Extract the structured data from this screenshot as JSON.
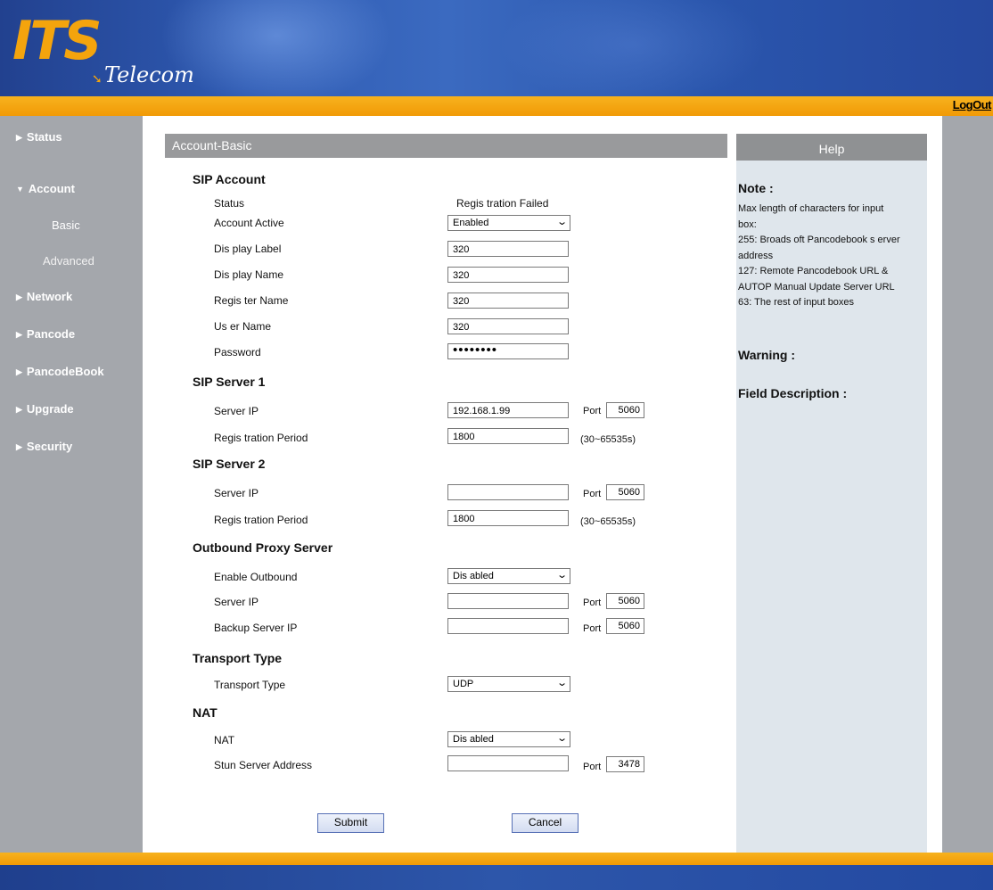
{
  "brand": {
    "its": "ITS",
    "telecom": "Telecom"
  },
  "topbar": {
    "logout": "LogOut"
  },
  "sidebar": {
    "items": [
      {
        "label": "Status"
      },
      {
        "label": "Account"
      },
      {
        "label": "Network"
      },
      {
        "label": "Pancode"
      },
      {
        "label": "PancodeBook"
      },
      {
        "label": "Upgrade"
      },
      {
        "label": "Security"
      }
    ],
    "account_sub": [
      "Basic",
      "Advanced"
    ]
  },
  "page": {
    "title": "Account-Basic"
  },
  "sip_account": {
    "heading": "SIP Account",
    "status_label": "Status",
    "status_value": "Regis tration Failed",
    "account_active_label": "Account Active",
    "account_active_value": "Enabled",
    "display_label_label": "Dis play Label",
    "display_label_value": "320",
    "display_name_label": "Dis play Name",
    "display_name_value": "320",
    "register_name_label": "Regis ter Name",
    "register_name_value": "320",
    "user_name_label": "Us er Name",
    "user_name_value": "320",
    "password_label": "Password",
    "password_value": "••••••••"
  },
  "sip_server1": {
    "heading": "SIP Server 1",
    "server_ip_label": "Server IP",
    "server_ip_value": "192.168.1.99",
    "port_label": "Port",
    "port_value": "5060",
    "reg_period_label": "Regis tration Period",
    "reg_period_value": "1800",
    "range": "(30~65535s)"
  },
  "sip_server2": {
    "heading": "SIP Server 2",
    "server_ip_label": "Server IP",
    "server_ip_value": "",
    "port_label": "Port",
    "port_value": "5060",
    "reg_period_label": "Regis tration Period",
    "reg_period_value": "1800",
    "range": "(30~65535s)"
  },
  "outbound": {
    "heading": "Outbound Proxy Server",
    "enable_label": "Enable Outbound",
    "enable_value": "Dis abled",
    "server_ip_label": "Server IP",
    "server_ip_value": "",
    "port_label": "Port",
    "port_value": "5060",
    "backup_label": "Backup Server IP",
    "backup_value": "",
    "backup_port_label": "Port",
    "backup_port_value": "5060"
  },
  "transport": {
    "heading": "Transport Type",
    "label": "Transport Type",
    "value": "UDP"
  },
  "nat": {
    "heading": "NAT",
    "label": "NAT",
    "value": "Dis abled",
    "stun_label": "Stun Server Address",
    "stun_value": "",
    "port_label": "Port",
    "port_value": "3478"
  },
  "buttons": {
    "submit": "Submit",
    "cancel": "Cancel"
  },
  "help": {
    "title": "Help",
    "note_heading": "Note :",
    "note_lines": [
      "Max length of characters for input",
      "box:",
      "255: Broads oft Pancodebook s erver",
      "address",
      "127: Remote Pancodebook URL &",
      "AUTOP Manual Update Server URL",
      "63: The rest of input boxes"
    ],
    "warning_heading": "Warning :",
    "field_heading": "Field Description :"
  },
  "colors": {
    "accent_orange": "#f4a40d",
    "header_blue": "#2a56ad",
    "sidebar_gray": "#a4a7ac",
    "help_bg": "#dfe6ec"
  }
}
